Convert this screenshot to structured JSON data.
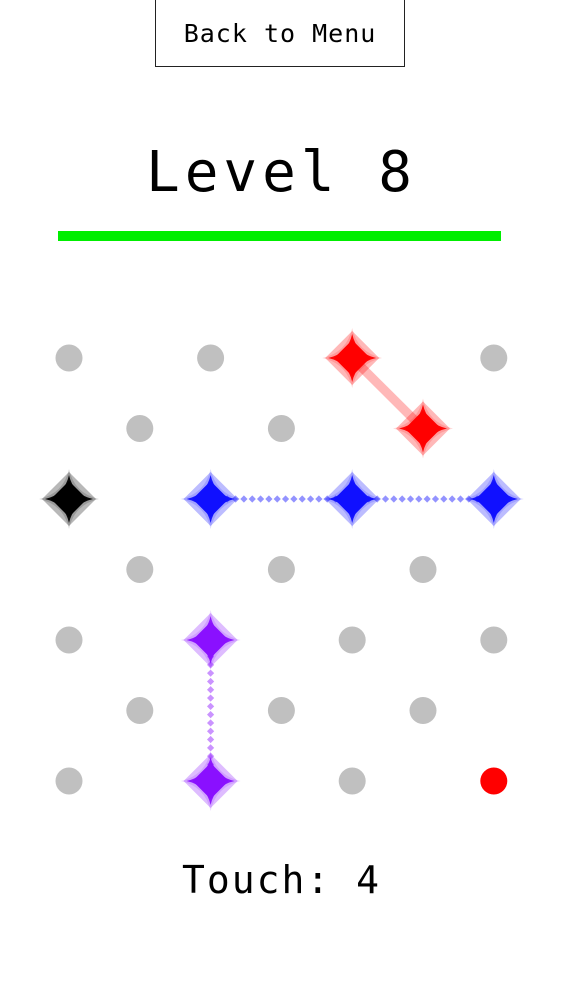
{
  "header": {
    "back_label": "Back to Menu",
    "level_title": "Level 8"
  },
  "progress": {
    "fraction": 1.0,
    "color": "#00ee00"
  },
  "colors": {
    "empty_dot": "#c0c0c0",
    "red": "#ff0000",
    "blue": "#1010ff",
    "purple": "#8a10ff",
    "black": "#000000"
  },
  "board": {
    "grid": [
      [
        "dot",
        null,
        "dot",
        null,
        "red",
        null,
        "dot"
      ],
      [
        null,
        "dot",
        null,
        "dot",
        null,
        "red",
        null
      ],
      [
        "black",
        null,
        "blue",
        null,
        "blue",
        null,
        "blue"
      ],
      [
        null,
        "dot",
        null,
        "dot",
        null,
        "dot",
        null
      ],
      [
        "dot",
        null,
        "purple",
        null,
        "dot",
        null,
        "dot"
      ],
      [
        null,
        "dot",
        null,
        "dot",
        null,
        "dot",
        null
      ],
      [
        "dot",
        null,
        "purple",
        null,
        "dot",
        null,
        "small-red"
      ]
    ],
    "links": [
      {
        "from": [
          0,
          4
        ],
        "to": [
          1,
          5
        ],
        "color": "red",
        "style": "solid"
      },
      {
        "from": [
          2,
          2
        ],
        "to": [
          2,
          4
        ],
        "color": "blue",
        "style": "dotted"
      },
      {
        "from": [
          2,
          4
        ],
        "to": [
          2,
          6
        ],
        "color": "blue",
        "style": "dotted"
      },
      {
        "from": [
          4,
          2
        ],
        "to": [
          6,
          2
        ],
        "color": "purple",
        "style": "dotted"
      }
    ]
  },
  "status": {
    "touch_label": "Touch:",
    "touch_count": "4"
  }
}
